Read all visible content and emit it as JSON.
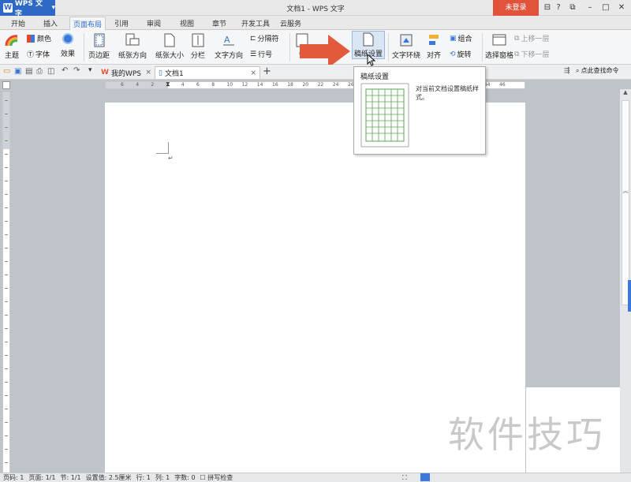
{
  "titlebar": {
    "app_name": "WPS 文字",
    "window_title": "文档1 - WPS 文字",
    "login": "未登录",
    "icons": [
      "skin-icon",
      "help-icon",
      "minimize-icon",
      "maximize-icon",
      "restore-icon",
      "close-icon"
    ]
  },
  "tabs": [
    "开始",
    "插入",
    "页面布局",
    "引用",
    "审阅",
    "视图",
    "章节",
    "开发工具",
    "云服务"
  ],
  "active_tab": "页面布局",
  "ribbon": {
    "theme": "主题",
    "color": "颜色",
    "font": "字体",
    "effect": "效果",
    "margins": "页边距",
    "orientation": "纸张方向",
    "size": "纸张大小",
    "columns": "分栏",
    "text_direction": "文字方向",
    "break": "分隔符",
    "line_number": "行号",
    "background": "背",
    "manuscript": "稿纸设置",
    "wrap": "文字环绕",
    "align": "对齐",
    "group": "组合",
    "rotate": "旋转",
    "selection_pane": "选择窗格",
    "bring_forward": "上移一层",
    "send_backward": "下移一层"
  },
  "doc_tabs": {
    "my_wps": "我的WPS",
    "doc1": "文档1",
    "add": "+",
    "search": "点此查找命令"
  },
  "ruler": {
    "h_labels": [
      "6",
      "4",
      "2",
      "2",
      "4",
      "6",
      "8",
      "10",
      "12",
      "14",
      "16",
      "18",
      "20",
      "22",
      "24",
      "26",
      "28",
      "30",
      "32",
      "34",
      "36",
      "38",
      "40",
      "42",
      "44",
      "46"
    ]
  },
  "tooltip": {
    "title": "稿纸设置",
    "desc": "对当前文档设置稿纸样式。"
  },
  "status": {
    "page_num": "页码: 1",
    "pages": "页面: 1/1",
    "section": "节: 1/1",
    "setting": "设置值: 2.5厘米",
    "row": "行: 1",
    "col": "列: 1",
    "words": "字数: 0",
    "spell": "拼写检查"
  },
  "watermark": "软件技巧",
  "colors": {
    "accent": "#2f69c6",
    "login": "#e2533c",
    "arrow": "#e15a3c"
  }
}
